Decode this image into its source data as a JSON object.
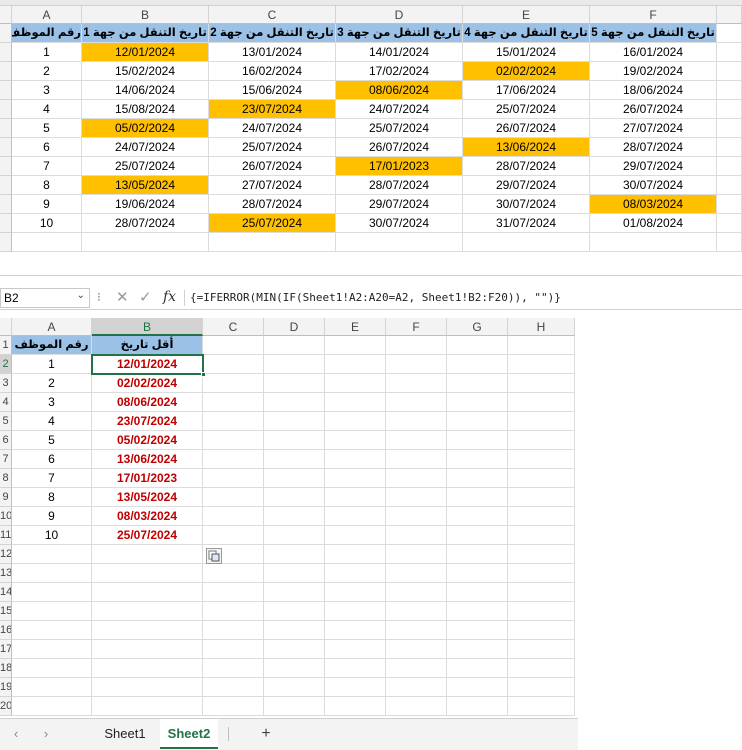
{
  "sheet1": {
    "col_letters": [
      "A",
      "B",
      "C",
      "D",
      "E",
      "F"
    ],
    "headers": [
      "رقم الموظف",
      "تاريخ التنقل من جهة 1",
      "تاريخ التنقل من جهة 2",
      "تاريخ التنقل من جهة 3",
      "تاريخ التنقل من جهة 4",
      "تاريخ التنقل من جهة 5"
    ],
    "rows": [
      [
        "1",
        "12/01/2024",
        "13/01/2024",
        "14/01/2024",
        "15/01/2024",
        "16/01/2024"
      ],
      [
        "2",
        "15/02/2024",
        "16/02/2024",
        "17/02/2024",
        "02/02/2024",
        "19/02/2024"
      ],
      [
        "3",
        "14/06/2024",
        "15/06/2024",
        "08/06/2024",
        "17/06/2024",
        "18/06/2024"
      ],
      [
        "4",
        "15/08/2024",
        "23/07/2024",
        "24/07/2024",
        "25/07/2024",
        "26/07/2024"
      ],
      [
        "5",
        "05/02/2024",
        "24/07/2024",
        "25/07/2024",
        "26/07/2024",
        "27/07/2024"
      ],
      [
        "6",
        "24/07/2024",
        "25/07/2024",
        "26/07/2024",
        "13/06/2024",
        "28/07/2024"
      ],
      [
        "7",
        "25/07/2024",
        "26/07/2024",
        "17/01/2023",
        "28/07/2024",
        "29/07/2024"
      ],
      [
        "8",
        "13/05/2024",
        "27/07/2024",
        "28/07/2024",
        "29/07/2024",
        "30/07/2024"
      ],
      [
        "9",
        "19/06/2024",
        "28/07/2024",
        "29/07/2024",
        "30/07/2024",
        "08/03/2024"
      ],
      [
        "10",
        "28/07/2024",
        "25/07/2024",
        "30/07/2024",
        "31/07/2024",
        "01/08/2024"
      ]
    ],
    "highlighted": [
      [
        0,
        1
      ],
      [
        1,
        4
      ],
      [
        2,
        3
      ],
      [
        3,
        2
      ],
      [
        4,
        1
      ],
      [
        5,
        4
      ],
      [
        6,
        3
      ],
      [
        7,
        1
      ],
      [
        8,
        5
      ],
      [
        9,
        2
      ]
    ],
    "highlight_color": "#ffc000",
    "header_color": "#9bc2e6"
  },
  "formula_bar": {
    "name_box": "B2",
    "fx_label": "fx",
    "formula": "{=IFERROR(MIN(IF(Sheet1!A2:A20=A2, Sheet1!B2:F20)), \"\")}"
  },
  "sheet2": {
    "col_letters": [
      "A",
      "B",
      "C",
      "D",
      "E",
      "F",
      "G",
      "H"
    ],
    "headers": [
      "رقم الموظف",
      "أقل تاريخ"
    ],
    "rows": [
      [
        "1",
        "12/01/2024"
      ],
      [
        "2",
        "02/02/2024"
      ],
      [
        "3",
        "08/06/2024"
      ],
      [
        "4",
        "23/07/2024"
      ],
      [
        "5",
        "05/02/2024"
      ],
      [
        "6",
        "13/06/2024"
      ],
      [
        "7",
        "17/01/2023"
      ],
      [
        "8",
        "13/05/2024"
      ],
      [
        "9",
        "08/03/2024"
      ],
      [
        "10",
        "25/07/2024"
      ]
    ],
    "row_numbers": [
      "1",
      "2",
      "3",
      "4",
      "5",
      "6",
      "7",
      "8",
      "9",
      "10",
      "11",
      "12",
      "13",
      "14",
      "15",
      "16",
      "17",
      "18",
      "19",
      "20"
    ],
    "result_color": "#c00000"
  },
  "tabs": {
    "items": [
      "Sheet1",
      "Sheet2"
    ],
    "active_index": 1,
    "add_label": "+"
  }
}
